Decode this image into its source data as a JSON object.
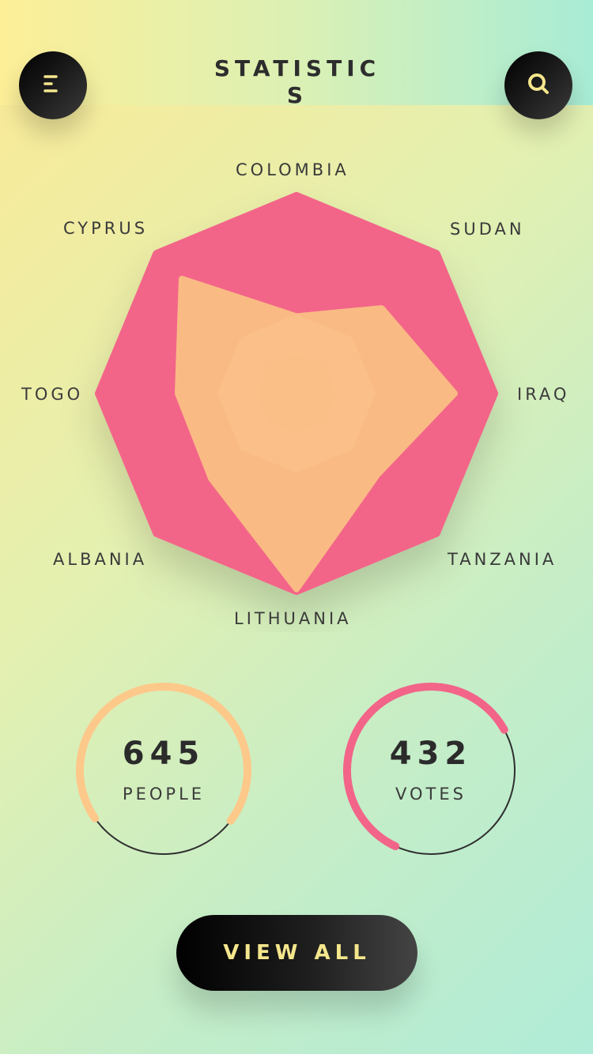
{
  "header": {
    "title": "STATISTICS"
  },
  "icons": {
    "menu": "menu-icon",
    "search": "search-icon"
  },
  "colors": {
    "radar_fill": "#f26589",
    "data_fill": "#fbbd84",
    "people_ring": "#fdc98b",
    "votes_ring": "#f26589",
    "button_text": "#f4e68c"
  },
  "radar": {
    "axes": [
      "COLOMBIA",
      "SUDAN",
      "IRAQ",
      "TANZANIA",
      "LITHUANIA",
      "ALBANIA",
      "TOGO",
      "CYPRUS"
    ],
    "values": [
      0.39,
      0.61,
      0.8,
      0.58,
      0.99,
      0.61,
      0.6,
      0.82
    ]
  },
  "stats": [
    {
      "value": "645",
      "label": "PEOPLE",
      "progress": 0.7
    },
    {
      "value": "432",
      "label": "VOTES",
      "progress": 0.6
    }
  ],
  "actions": {
    "view_all": "VIEW ALL"
  }
}
